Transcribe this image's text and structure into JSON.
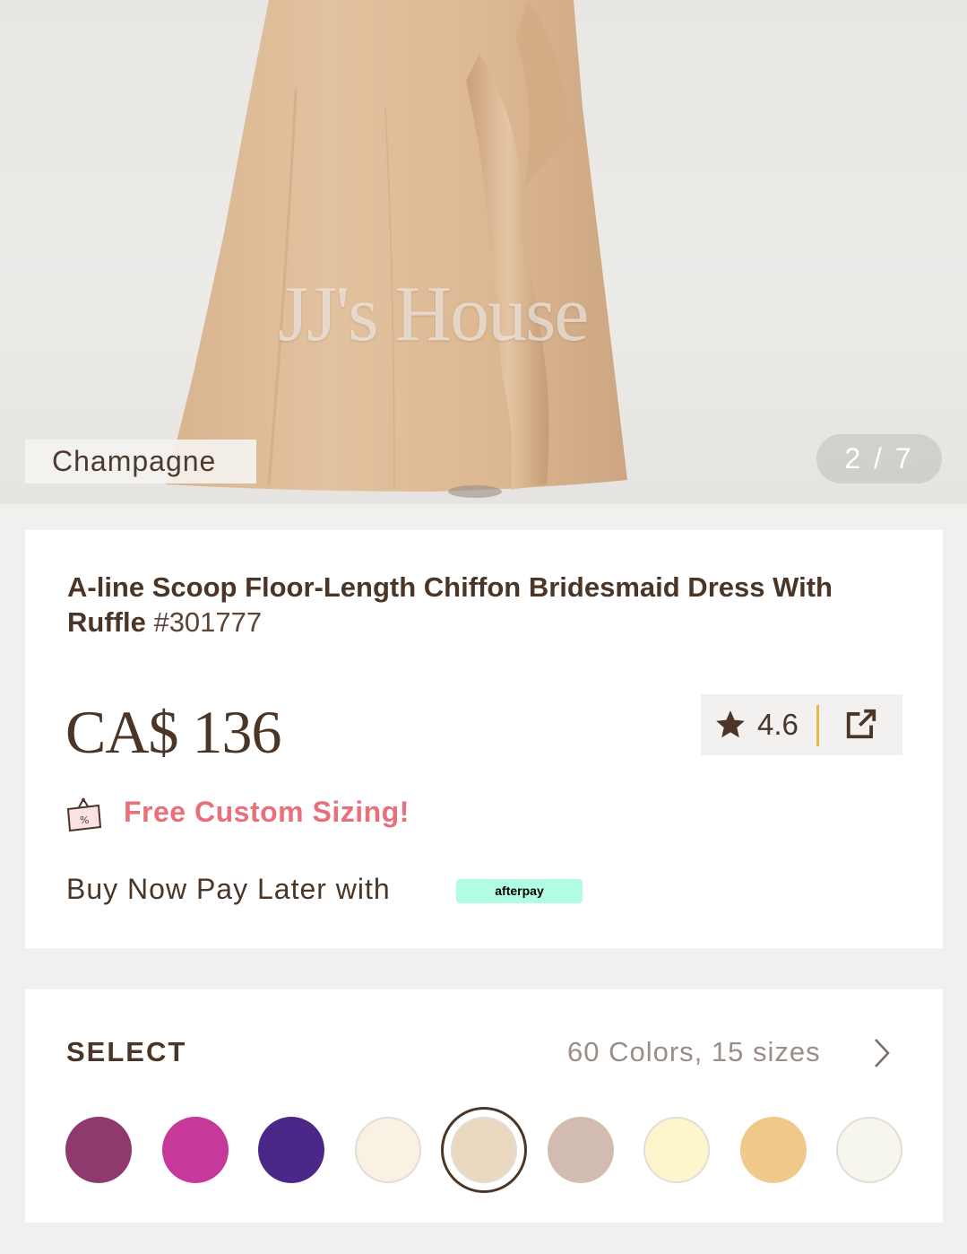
{
  "gallery": {
    "color_label": "Champagne",
    "counter": "2 / 7",
    "watermark": "JJ's House"
  },
  "product": {
    "title": "A-line Scoop Floor-Length Chiffon Bridesmaid Dress With Ruffle",
    "sku": "#301777",
    "price": "CA$ 136",
    "rating": "4.6",
    "icons": {
      "rating": "star-icon",
      "share": "share-icon",
      "promo": "price-tag-icon"
    }
  },
  "promo": {
    "text": "Free Custom Sizing!"
  },
  "payment": {
    "text": "Buy Now Pay Later with",
    "provider": "afterpay"
  },
  "select": {
    "label": "SELECT",
    "summary": "60 Colors, 15 sizes",
    "swatches": [
      {
        "color": "#8e3a6e",
        "selected": false
      },
      {
        "color": "#c6389a",
        "selected": false
      },
      {
        "color": "#4b2887",
        "selected": false
      },
      {
        "color": "#f8f1e4",
        "selected": false
      },
      {
        "color": "#ead8c1",
        "selected": true
      },
      {
        "color": "#d2bcb2",
        "selected": false
      },
      {
        "color": "#fdf6cc",
        "selected": false
      },
      {
        "color": "#f0c98a",
        "selected": false
      },
      {
        "color": "#f6f6ee",
        "selected": false
      }
    ]
  },
  "colors": {
    "text_dark": "#4a3526",
    "promo_pink": "#e96f7b",
    "afterpay_mint": "#b2fce4",
    "rating_divider": "#e8b84a"
  }
}
